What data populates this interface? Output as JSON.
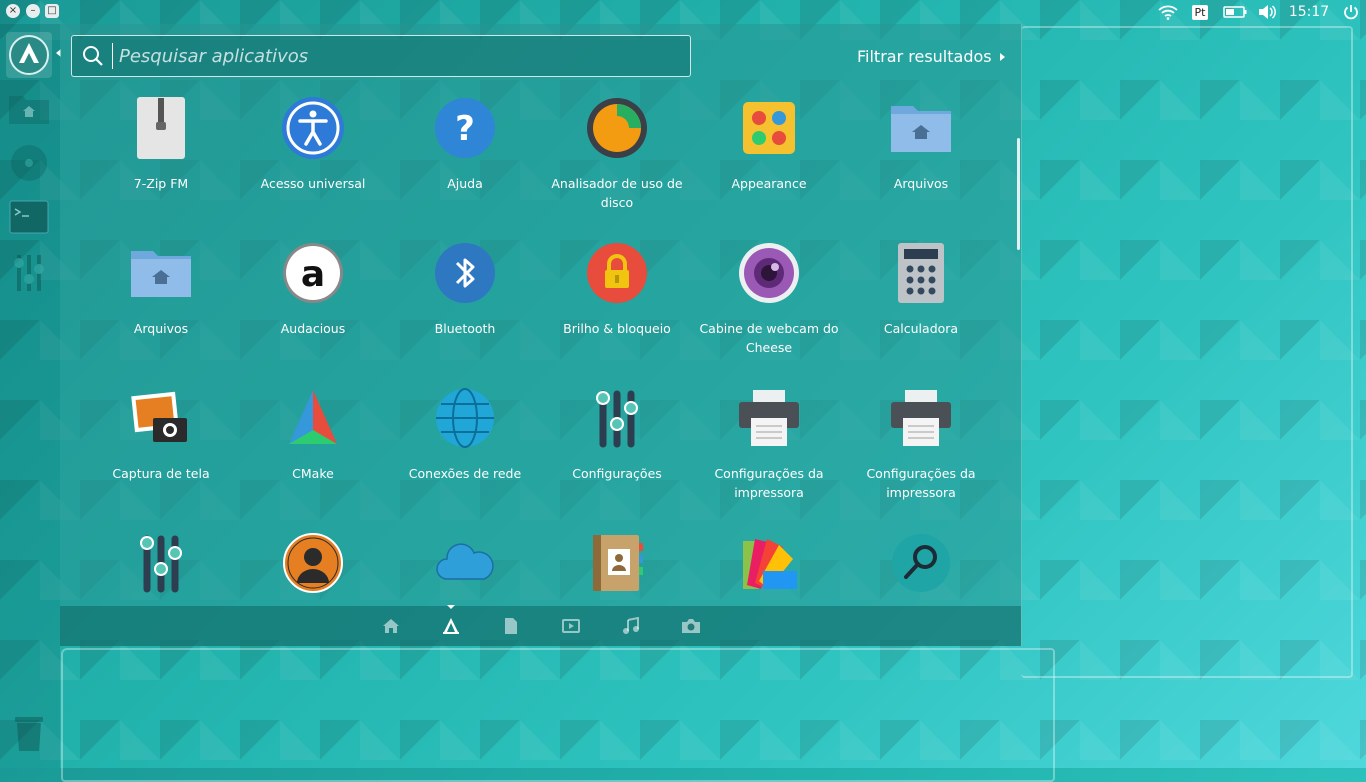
{
  "topbar": {
    "window_buttons": [
      "close-icon",
      "minimize-icon",
      "maximize-icon"
    ],
    "language": "Pt",
    "clock": "15:17",
    "icons": [
      "wifi-icon",
      "battery-icon",
      "volume-icon",
      "power-icon"
    ]
  },
  "dock": {
    "items": [
      "launcher-icon",
      "files-icon",
      "disc-icon",
      "terminal-icon",
      "settings-sliders-icon",
      "trash-icon"
    ]
  },
  "search": {
    "placeholder": "Pesquisar aplicativos",
    "value": ""
  },
  "filter": {
    "label": "Filtrar resultados"
  },
  "apps": [
    {
      "label": "7-Zip FM",
      "icon": "zip-icon"
    },
    {
      "label": "Acesso universal",
      "icon": "accessibility-icon"
    },
    {
      "label": "Ajuda",
      "icon": "help-icon"
    },
    {
      "label": "Analisador de uso de disco",
      "icon": "disk-usage-icon"
    },
    {
      "label": "Appearance",
      "icon": "appearance-icon"
    },
    {
      "label": "Arquivos",
      "icon": "folder-home-icon"
    },
    {
      "label": "Arquivos",
      "icon": "folder-home-icon"
    },
    {
      "label": "Audacious",
      "icon": "audacious-icon"
    },
    {
      "label": "Bluetooth",
      "icon": "bluetooth-icon"
    },
    {
      "label": "Brilho & bloqueio",
      "icon": "lock-icon"
    },
    {
      "label": "Cabine de webcam do Cheese",
      "icon": "webcam-icon"
    },
    {
      "label": "Calculadora",
      "icon": "calculator-icon"
    },
    {
      "label": "Captura de tela",
      "icon": "screenshot-icon"
    },
    {
      "label": "CMake",
      "icon": "cmake-icon"
    },
    {
      "label": "Conexões de rede",
      "icon": "network-globe-icon"
    },
    {
      "label": "Configurações",
      "icon": "settings-sliders-icon"
    },
    {
      "label": "Configurações da impressora",
      "icon": "printer-icon"
    },
    {
      "label": "Configurações da impressora",
      "icon": "printer-icon"
    },
    {
      "label": "",
      "icon": "settings-sliders-icon"
    },
    {
      "label": "",
      "icon": "user-icon"
    },
    {
      "label": "",
      "icon": "cloud-icon"
    },
    {
      "label": "",
      "icon": "contacts-icon"
    },
    {
      "label": "",
      "icon": "color-palette-icon"
    },
    {
      "label": "",
      "icon": "search-magnifier-icon"
    }
  ],
  "category_tabs": [
    "home-icon",
    "applications-icon",
    "documents-icon",
    "video-icon",
    "music-icon",
    "camera-icon"
  ],
  "selected_tab": "applications-icon"
}
